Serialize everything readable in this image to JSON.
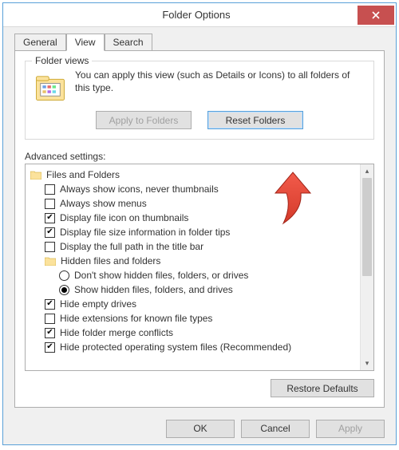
{
  "window": {
    "title": "Folder Options"
  },
  "tabs": {
    "general": "General",
    "view": "View",
    "search": "Search"
  },
  "folderViews": {
    "group_label": "Folder views",
    "text": "You can apply this view (such as Details or Icons) to all folders of this type.",
    "apply_btn": "Apply to Folders",
    "reset_btn": "Reset Folders"
  },
  "advanced": {
    "label": "Advanced settings:",
    "root": "Files and Folders",
    "items": [
      {
        "type": "check",
        "checked": false,
        "label": "Always show icons, never thumbnails"
      },
      {
        "type": "check",
        "checked": false,
        "label": "Always show menus"
      },
      {
        "type": "check",
        "checked": true,
        "label": "Display file icon on thumbnails"
      },
      {
        "type": "check",
        "checked": true,
        "label": "Display file size information in folder tips"
      },
      {
        "type": "check",
        "checked": false,
        "label": "Display the full path in the title bar"
      }
    ],
    "hidden_group": "Hidden files and folders",
    "hidden_options": [
      {
        "selected": false,
        "label": "Don't show hidden files, folders, or drives"
      },
      {
        "selected": true,
        "label": "Show hidden files, folders, and drives"
      }
    ],
    "items2": [
      {
        "type": "check",
        "checked": true,
        "label": "Hide empty drives"
      },
      {
        "type": "check",
        "checked": false,
        "label": "Hide extensions for known file types"
      },
      {
        "type": "check",
        "checked": true,
        "label": "Hide folder merge conflicts"
      },
      {
        "type": "check",
        "checked": true,
        "label": "Hide protected operating system files (Recommended)"
      }
    ],
    "restore_btn": "Restore Defaults"
  },
  "buttons": {
    "ok": "OK",
    "cancel": "Cancel",
    "apply": "Apply"
  }
}
